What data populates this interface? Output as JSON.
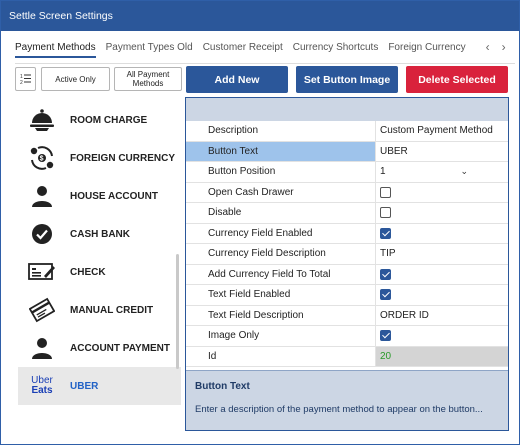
{
  "window": {
    "title": "Settle Screen Settings"
  },
  "tabs": [
    {
      "label": "Payment Methods",
      "active": true
    },
    {
      "label": "Payment Types Old",
      "active": false
    },
    {
      "label": "Customer Receipt",
      "active": false
    },
    {
      "label": "Currency Shortcuts",
      "active": false
    },
    {
      "label": "Foreign Currency",
      "active": false
    }
  ],
  "toolbar": {
    "active_only": "Active Only",
    "all_payment_methods_line1": "All Payment",
    "all_payment_methods_line2": "Methods",
    "add_new": "Add New",
    "set_button_image": "Set Button Image",
    "delete_selected": "Delete Selected"
  },
  "sidebar": {
    "items": [
      {
        "label": "ROOM CHARGE",
        "icon": "room-service-bell-icon"
      },
      {
        "label": "FOREIGN CURRENCY",
        "icon": "currency-exchange-icon"
      },
      {
        "label": "HOUSE ACCOUNT",
        "icon": "person-icon"
      },
      {
        "label": "CASH BANK",
        "icon": "check-circle-icon"
      },
      {
        "label": "CHECK",
        "icon": "check-document-icon"
      },
      {
        "label": "MANUAL CREDIT",
        "icon": "credit-card-slip-icon"
      },
      {
        "label": "ACCOUNT PAYMENT",
        "icon": "person-icon"
      },
      {
        "label": "UBER",
        "icon": "uber-eats-logo-icon",
        "logo_line1": "Uber",
        "logo_line2": "Eats"
      }
    ]
  },
  "grid": {
    "rows": [
      {
        "label": "Description",
        "value": "Custom Payment Method"
      },
      {
        "label": "Button Text",
        "value": "UBER",
        "selected": true
      },
      {
        "label": "Button Position",
        "value": "1",
        "type": "dropdown"
      },
      {
        "label": "Open Cash Drawer",
        "type": "checkbox",
        "checked": false
      },
      {
        "label": "Disable",
        "type": "checkbox",
        "checked": false
      },
      {
        "label": "Currency Field Enabled",
        "type": "checkbox",
        "checked": true
      },
      {
        "label": "Currency Field Description",
        "value": "TIP"
      },
      {
        "label": "Add Currency Field To Total",
        "type": "checkbox",
        "checked": true
      },
      {
        "label": "Text Field Enabled",
        "type": "checkbox",
        "checked": true
      },
      {
        "label": "Text Field Description",
        "value": "ORDER ID"
      },
      {
        "label": "Image Only",
        "type": "checkbox",
        "checked": true
      },
      {
        "label": "Id",
        "value": "20",
        "readonly": true
      }
    ]
  },
  "description": {
    "title": "Button Text",
    "text": "Enter a description of the payment method to appear on the button..."
  },
  "colors": {
    "titlebar": "#2b579a",
    "primary_button": "#2b579a",
    "danger_button": "#d9223c",
    "selected_row": "#9ec3eb",
    "active_sidebar_text": "#2262c6"
  }
}
